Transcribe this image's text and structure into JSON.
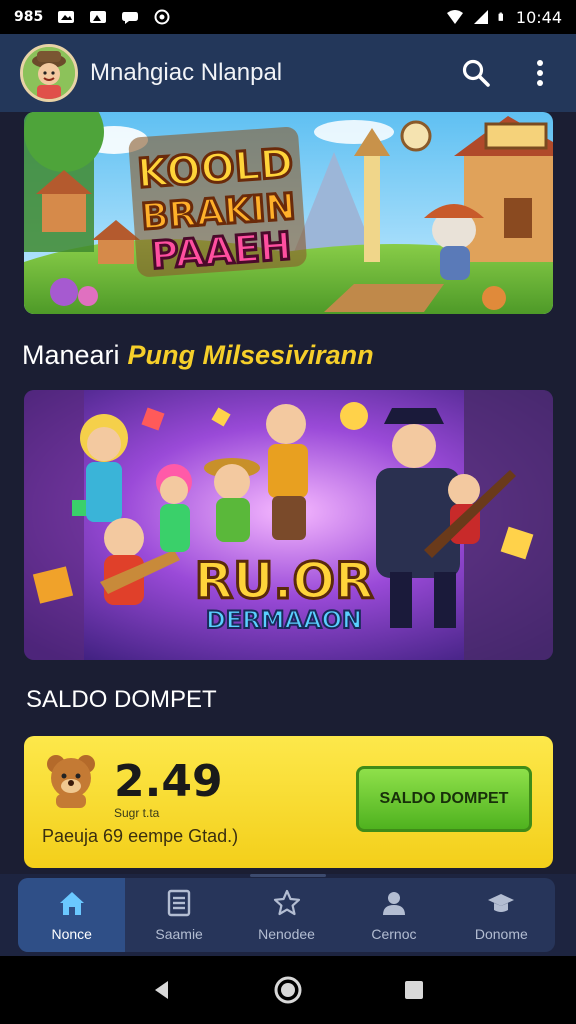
{
  "status_bar": {
    "time_left": "985",
    "time_right": "10:44"
  },
  "app_bar": {
    "title": "Mnahgiac Nlanpal",
    "search_icon": "search-icon",
    "menu_icon": "more-vertical-icon"
  },
  "banners": [
    {
      "line1": "KOOLD",
      "line2": "BRAKIN",
      "line3": "PAAEH"
    },
    {
      "line1": "RU.OR",
      "line2": "DERMAAON"
    }
  ],
  "section_heading": {
    "plain": "Maneari",
    "accent": "Pung Milsesivirann"
  },
  "wallet": {
    "heading": "SALDO DOMPET",
    "balance": "2.49",
    "balance_caption": "Sugr t.ta",
    "description": "Paeuja 69 eempe Gtad.)",
    "button_label": "SALDO DOMPET",
    "colors": {
      "card": "#f5d726",
      "button": "#5cc22a"
    }
  },
  "bottom_nav": {
    "items": [
      {
        "label": "Nonce",
        "icon": "home-icon",
        "active": true
      },
      {
        "label": "Saamie",
        "icon": "list-icon",
        "active": false
      },
      {
        "label": "Nenodee",
        "icon": "star-icon",
        "active": false
      },
      {
        "label": "Cernoc",
        "icon": "person-icon",
        "active": false
      },
      {
        "label": "Donome",
        "icon": "graduation-cap-icon",
        "active": false
      }
    ]
  },
  "colors": {
    "app_bar": "#23375a",
    "background": "#1b1e33",
    "accent": "#f6cf2a",
    "nav_active": "#2f4f87"
  }
}
